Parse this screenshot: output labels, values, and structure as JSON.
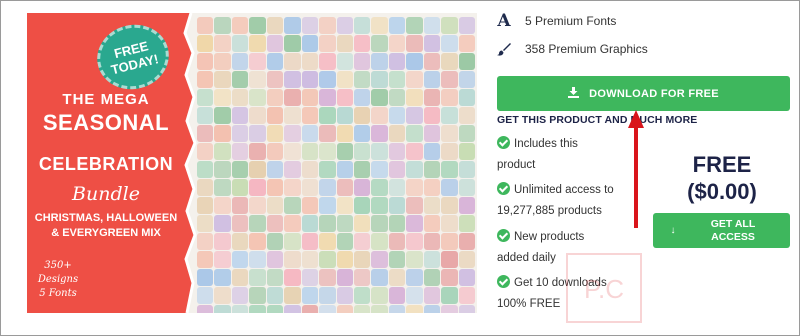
{
  "product": {
    "badge_line1": "FREE",
    "badge_line2": "TODAY!",
    "title_line1": "THE MEGA",
    "title_line2": "SEASONAL",
    "title_line3": "CELEBRATION",
    "title_line4": "Bundle",
    "subtitle_line1": "CHRISTMAS, HALLOWEEN",
    "subtitle_line2": "& EVERYGREEN MIX",
    "designs_line1": "350+ Designs",
    "designs_line2": "5 Fonts",
    "red_color": "#ee4f45"
  },
  "info": {
    "fonts_icon": "font-letter-icon",
    "fonts_label": "5 Premium Fonts",
    "graphics_icon": "brush-icon",
    "graphics_label": "358 Premium Graphics"
  },
  "download_button": {
    "icon": "download-icon",
    "label": "DOWNLOAD FOR FREE",
    "color": "#3eb75d"
  },
  "get_link": "GET THIS PRODUCT AND MUCH MORE",
  "features": [
    {
      "line1": "Includes this",
      "line2": "product"
    },
    {
      "line1": "Unlimited access to",
      "line2": "19,277,885 products"
    },
    {
      "line1": "New products",
      "line2": "added daily"
    },
    {
      "line1": "Get 10 downloads",
      "line2": "100% FREE"
    }
  ],
  "pricing": {
    "label": "FREE",
    "value": "($0.00)"
  },
  "access_button": {
    "icon": "arrow-down-icon",
    "line1": "GET ALL",
    "line2": "ACCESS"
  },
  "annotation": {
    "arrow_color": "#d9151b",
    "watermark_text": "P.C"
  }
}
